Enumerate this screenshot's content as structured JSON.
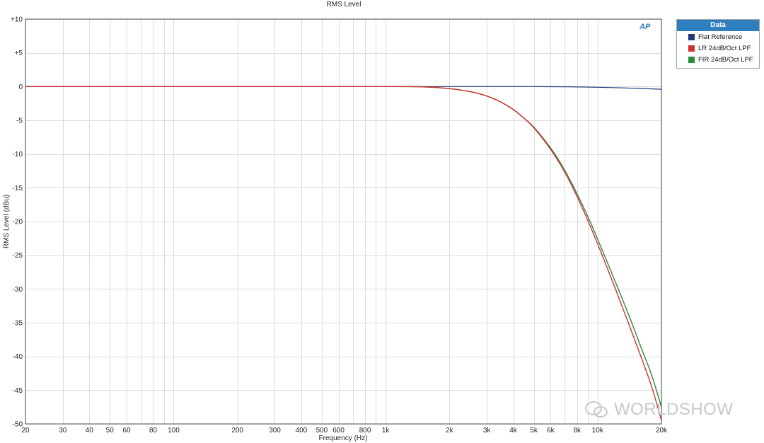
{
  "chart_data": {
    "type": "line",
    "title": "RMS Level",
    "xlabel": "Frequency (Hz)",
    "ylabel": "RMS Level (dBu)",
    "xscale": "log",
    "xlim": [
      20,
      20000
    ],
    "ylim": [
      -50,
      10
    ],
    "grid": true,
    "legend_placement": "right",
    "legend_title": "Data",
    "x_ticks": [
      20,
      30,
      40,
      50,
      60,
      80,
      100,
      200,
      300,
      400,
      500,
      600,
      800,
      1000,
      2000,
      3000,
      4000,
      5000,
      6000,
      8000,
      10000,
      20000
    ],
    "x_tick_labels": [
      "20",
      "30",
      "40",
      "50",
      "60",
      "80",
      "100",
      "200",
      "300",
      "400",
      "500",
      "600",
      "800",
      "1k",
      "2k",
      "3k",
      "4k",
      "5k",
      "6k",
      "8k",
      "10k",
      "20k"
    ],
    "y_ticks": [
      10,
      5,
      0,
      -5,
      -10,
      -15,
      -20,
      -25,
      -30,
      -35,
      -40,
      -45,
      -50
    ],
    "y_tick_labels": [
      "+10",
      "+5",
      "0",
      "-5",
      "-10",
      "-15",
      "-20",
      "-25",
      "-30",
      "-35",
      "-40",
      "-45",
      "-50"
    ],
    "series": [
      {
        "name": "Flat Reference",
        "color": "#1f3a7a",
        "x": [
          20,
          100,
          1000,
          5000,
          10000,
          15000,
          20000
        ],
        "y": [
          0,
          0,
          0,
          0,
          -0.1,
          -0.25,
          -0.4
        ]
      },
      {
        "name": "LR 24dB/Oct LPF",
        "color": "#d03030",
        "x": [
          20,
          100,
          1000,
          1500,
          2000,
          2500,
          3000,
          3500,
          4000,
          4500,
          5000,
          6000,
          7000,
          8000,
          9000,
          10000,
          12000,
          14000,
          16000,
          18000,
          20000
        ],
        "y": [
          0,
          0,
          0,
          -0.05,
          -0.3,
          -0.75,
          -1.4,
          -2.3,
          -3.4,
          -4.7,
          -6.1,
          -9.3,
          -12.7,
          -16.3,
          -19.9,
          -23.3,
          -29.6,
          -35.1,
          -40.0,
          -44.5,
          -49.5
        ]
      },
      {
        "name": "FIR 24dB/Oct LPF",
        "color": "#2a8a3e",
        "x": [
          20,
          100,
          1000,
          1500,
          2000,
          2500,
          3000,
          3500,
          4000,
          4500,
          5000,
          6000,
          7000,
          8000,
          9000,
          10000,
          12000,
          14000,
          16000,
          18000,
          20000
        ],
        "y": [
          0,
          0,
          0,
          -0.05,
          -0.3,
          -0.75,
          -1.4,
          -2.3,
          -3.4,
          -4.7,
          -6.0,
          -9.1,
          -12.4,
          -15.9,
          -19.3,
          -22.6,
          -28.6,
          -33.8,
          -38.6,
          -42.8,
          -47.5
        ]
      }
    ]
  },
  "logo_text": "AP",
  "watermark_text": "WORLDSHOW"
}
